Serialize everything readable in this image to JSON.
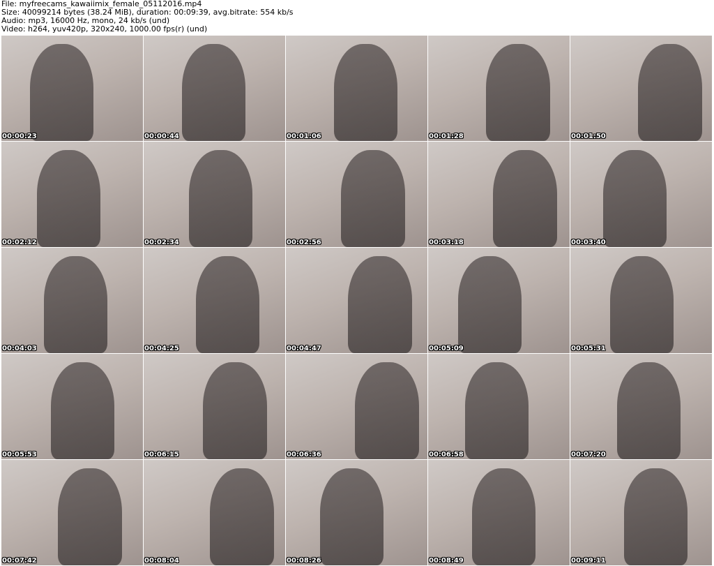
{
  "header": {
    "file": "File: myfreecams_kawaiimix_female_05112016.mp4",
    "size": "Size: 40099214 bytes (38.24 MiB), duration: 00:09:39, avg.bitrate: 554 kb/s",
    "audio": "Audio: mp3, 16000 Hz, mono, 24 kb/s (und)",
    "video": "Video: h264, yuv420p, 320x240, 1000.00 fps(r) (und)"
  },
  "thumbnails": [
    "00:00:23",
    "00:00:44",
    "00:01:06",
    "00:01:28",
    "00:01:50",
    "00:02:12",
    "00:02:34",
    "00:02:56",
    "00:03:18",
    "00:03:40",
    "00:04:03",
    "00:04:25",
    "00:04:47",
    "00:05:09",
    "00:05:31",
    "00:05:53",
    "00:06:15",
    "00:06:36",
    "00:06:58",
    "00:07:20",
    "00:07:42",
    "00:08:04",
    "00:08:26",
    "00:08:49",
    "00:09:11"
  ]
}
